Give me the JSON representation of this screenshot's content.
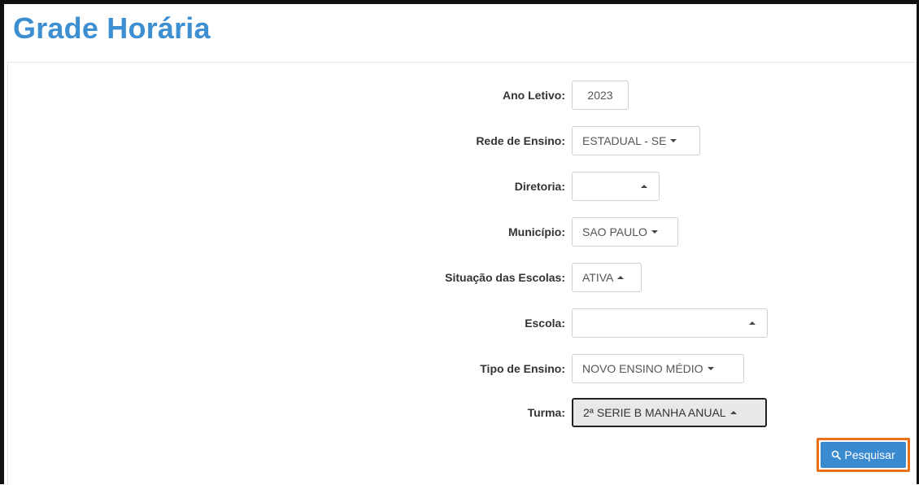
{
  "page": {
    "title": "Grade Horária"
  },
  "form": {
    "ano_letivo": {
      "label": "Ano Letivo:",
      "value": "2023"
    },
    "rede_ensino": {
      "label": "Rede de Ensino:",
      "value": "ESTADUAL - SE"
    },
    "diretoria": {
      "label": "Diretoria:",
      "value": ""
    },
    "municipio": {
      "label": "Município:",
      "value": "SAO PAULO"
    },
    "situacao": {
      "label": "Situação das Escolas:",
      "value": "ATIVA"
    },
    "escola": {
      "label": "Escola:",
      "value": ""
    },
    "tipo_ensino": {
      "label": "Tipo de Ensino:",
      "value": "NOVO ENSINO MÉDIO"
    },
    "turma": {
      "label": "Turma:",
      "value": "2ª SERIE B MANHA ANUAL"
    }
  },
  "actions": {
    "search_label": "Pesquisar",
    "search_icon": "search-icon"
  },
  "colors": {
    "title": "#3d8fd1",
    "button": "#3a8ad0",
    "highlight": "#e8701a"
  }
}
